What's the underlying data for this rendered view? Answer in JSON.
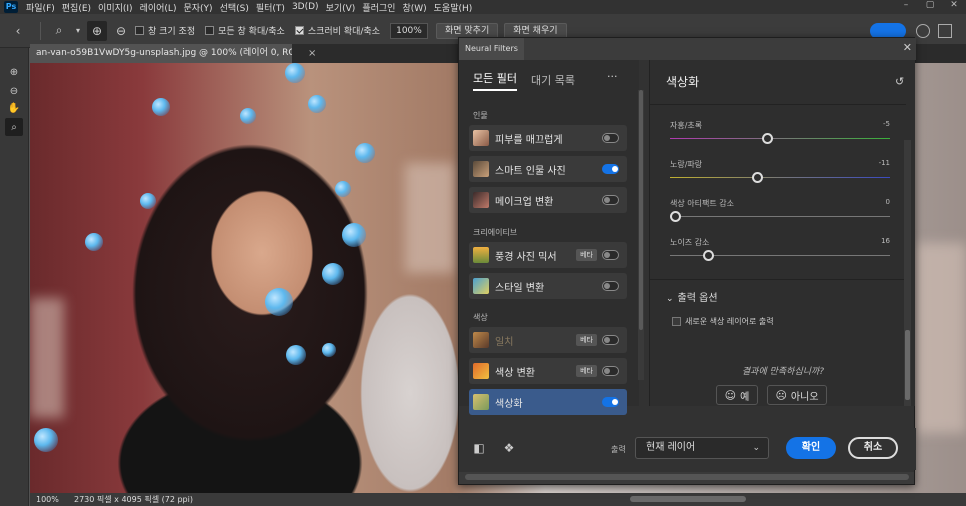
{
  "menu": {
    "items": [
      "파일(F)",
      "편집(E)",
      "이미지(I)",
      "레이어(L)",
      "문자(Y)",
      "선택(S)",
      "필터(T)",
      "3D(D)",
      "보기(V)",
      "플러그인",
      "창(W)",
      "도움말(H)"
    ]
  },
  "options": {
    "resize_windows": "창 크기 조정",
    "zoom_all": "모든 창 확대/축소",
    "scrubby_zoom": "스크러비 확대/축소",
    "zoom_value": "100%",
    "fit_screen": "화면 맞추기",
    "fill_screen": "화면 채우기"
  },
  "document": {
    "tab_title": "an-van-o59B1VwDY5g-unsplash.jpg @ 100% (레이어 0, RGB/8) *",
    "close_glyph": "×"
  },
  "status": {
    "zoom": "100%",
    "size": "2730 픽셀 x 4095 픽셀 (72 ppi)"
  },
  "neural_filters": {
    "title": "Neural Filters",
    "tabs": [
      "모든 필터",
      "대기 목록"
    ],
    "more": "···",
    "categories": {
      "portrait": "인물",
      "creative": "크리에이티브",
      "color": "색상"
    },
    "filters": {
      "skin": {
        "label": "피부를 매끄럽게",
        "on": false
      },
      "smart_portrait": {
        "label": "스마트 인물 사진",
        "on": true
      },
      "makeup": {
        "label": "메이크업 변환",
        "on": false
      },
      "landscape": {
        "label": "풍경 사진 믹서",
        "badge": "베타",
        "on": false
      },
      "style": {
        "label": "스타일 변환",
        "on": false
      },
      "harmonize": {
        "label": "일치",
        "badge": "베타",
        "on": false
      },
      "color_transfer": {
        "label": "색상 변환",
        "badge": "베타",
        "on": false
      },
      "colorize": {
        "label": "색상화",
        "on": true
      }
    },
    "panel": {
      "heading": "색상화",
      "sliders": {
        "magenta_green": {
          "label": "자홍/초록",
          "value": "-5",
          "fraction": 0.44
        },
        "yellow_blue": {
          "label": "노랑/파랑",
          "value": "-11",
          "fraction": 0.39
        },
        "artifact": {
          "label": "색상 아티팩트 감소",
          "value": "0",
          "fraction": 0.0
        },
        "noise": {
          "label": "노이즈 감소",
          "value": "16",
          "fraction": 0.16
        }
      },
      "output_options": "출력 옵션",
      "new_color_layer": "새로운 색상 레이어로 출력",
      "feedback_question": "결과에 만족하십니까?",
      "yes": "예",
      "no": "아니오"
    },
    "footer": {
      "output_label": "출력",
      "output_value": "현재 레이어",
      "ok": "확인",
      "cancel": "취소"
    }
  }
}
